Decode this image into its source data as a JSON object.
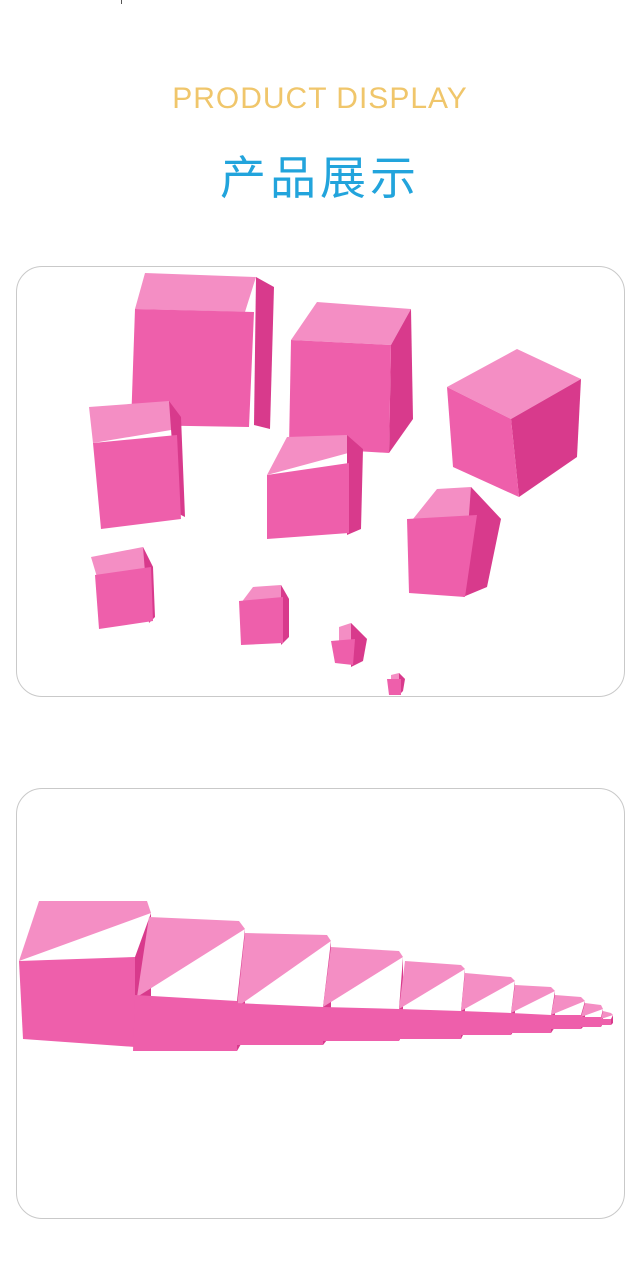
{
  "header": {
    "subtitle": "PRODUCT DISPLAY",
    "title": "产品展示"
  },
  "colors": {
    "subtitle": "#f0c66b",
    "title": "#22a4dc",
    "cube_top": "#f48ec4",
    "cube_front": "#ee5fab",
    "cube_side": "#d83a8c",
    "panel_border": "#c9c9c9"
  },
  "photos": [
    {
      "name": "scattered-pink-cubes",
      "cube_count": 10
    },
    {
      "name": "pink-tower-row",
      "cube_count": 10
    }
  ]
}
